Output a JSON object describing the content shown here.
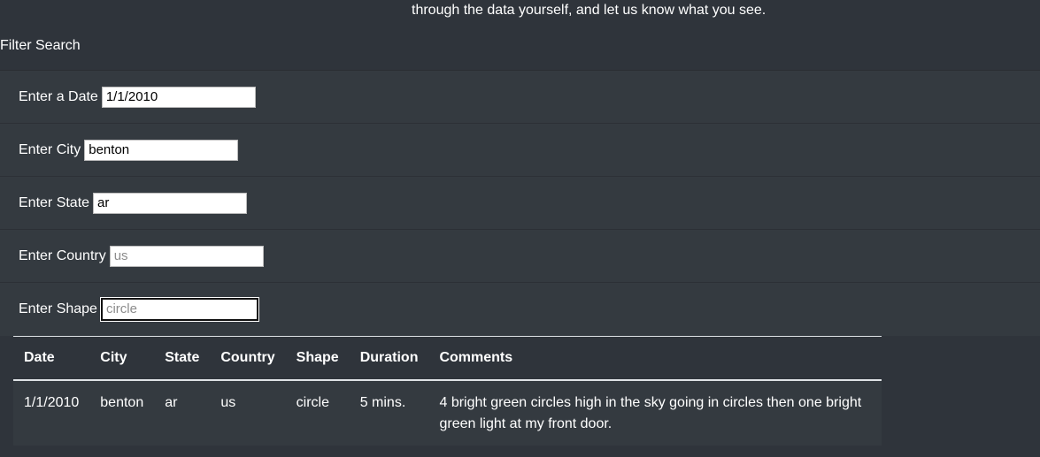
{
  "intro": {
    "text": "through the data yourself, and let us know what you see."
  },
  "filter": {
    "title": "Filter Search",
    "fields": [
      {
        "label": "Enter a Date",
        "value": "1/1/2010",
        "placeholder": ""
      },
      {
        "label": "Enter City",
        "value": "benton",
        "placeholder": ""
      },
      {
        "label": "Enter State",
        "value": "ar",
        "placeholder": ""
      },
      {
        "label": "Enter Country",
        "value": "",
        "placeholder": "us"
      },
      {
        "label": "Enter Shape",
        "value": "",
        "placeholder": "circle"
      }
    ]
  },
  "table": {
    "headers": [
      "Date",
      "City",
      "State",
      "Country",
      "Shape",
      "Duration",
      "Comments"
    ],
    "rows": [
      [
        "1/1/2010",
        "benton",
        "ar",
        "us",
        "circle",
        "5 mins.",
        "4 bright green circles high in the sky going in circles then one bright green light at my front door."
      ]
    ]
  },
  "colors": {
    "page_background": "#2f343b",
    "panel_background": "#343a40",
    "text": "#ffffff"
  }
}
